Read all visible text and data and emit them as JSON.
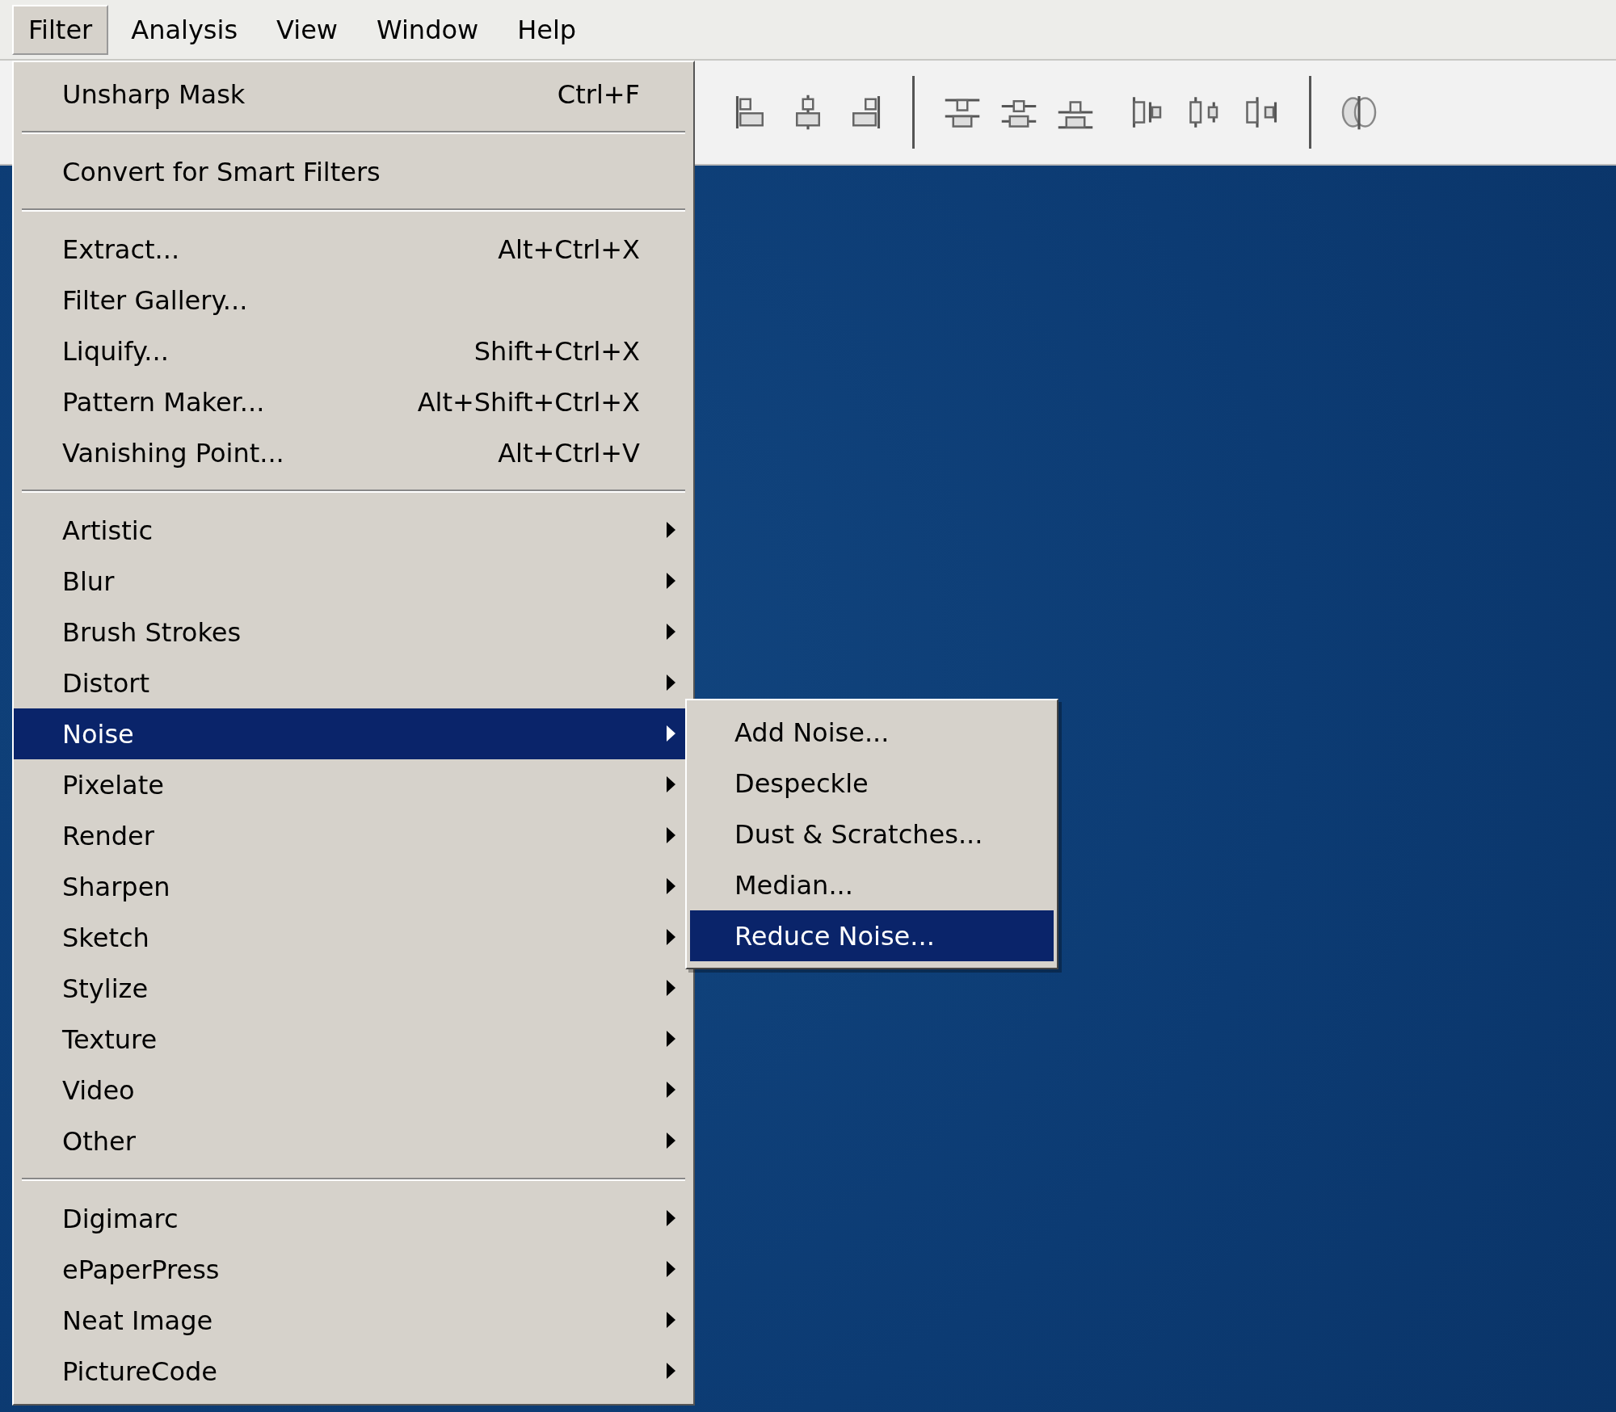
{
  "menu_bar": [
    {
      "label": "Filter",
      "selected": true
    },
    {
      "label": "Analysis",
      "selected": false
    },
    {
      "label": "View",
      "selected": false
    },
    {
      "label": "Window",
      "selected": false
    },
    {
      "label": "Help",
      "selected": false
    }
  ],
  "filter_menu": {
    "sections": [
      {
        "items": [
          {
            "label": "Unsharp Mask",
            "shortcut": "Ctrl+F",
            "submenu": false,
            "selected": false
          }
        ]
      },
      {
        "items": [
          {
            "label": "Convert for Smart Filters",
            "submenu": false,
            "selected": false
          }
        ]
      },
      {
        "items": [
          {
            "label": "Extract...",
            "shortcut": "Alt+Ctrl+X",
            "submenu": false,
            "selected": false
          },
          {
            "label": "Filter Gallery...",
            "submenu": false,
            "selected": false
          },
          {
            "label": "Liquify...",
            "shortcut": "Shift+Ctrl+X",
            "submenu": false,
            "selected": false
          },
          {
            "label": "Pattern Maker...",
            "shortcut": "Alt+Shift+Ctrl+X",
            "submenu": false,
            "selected": false
          },
          {
            "label": "Vanishing Point...",
            "shortcut": "Alt+Ctrl+V",
            "submenu": false,
            "selected": false
          }
        ]
      },
      {
        "items": [
          {
            "label": "Artistic",
            "submenu": true,
            "selected": false
          },
          {
            "label": "Blur",
            "submenu": true,
            "selected": false
          },
          {
            "label": "Brush Strokes",
            "submenu": true,
            "selected": false
          },
          {
            "label": "Distort",
            "submenu": true,
            "selected": false
          },
          {
            "label": "Noise",
            "submenu": true,
            "selected": true,
            "children": [
              {
                "label": "Add Noise...",
                "selected": false
              },
              {
                "label": "Despeckle",
                "selected": false
              },
              {
                "label": "Dust & Scratches...",
                "selected": false
              },
              {
                "label": "Median...",
                "selected": false
              },
              {
                "label": "Reduce Noise...",
                "selected": true
              }
            ]
          },
          {
            "label": "Pixelate",
            "submenu": true,
            "selected": false
          },
          {
            "label": "Render",
            "submenu": true,
            "selected": false
          },
          {
            "label": "Sharpen",
            "submenu": true,
            "selected": false
          },
          {
            "label": "Sketch",
            "submenu": true,
            "selected": false
          },
          {
            "label": "Stylize",
            "submenu": true,
            "selected": false
          },
          {
            "label": "Texture",
            "submenu": true,
            "selected": false
          },
          {
            "label": "Video",
            "submenu": true,
            "selected": false
          },
          {
            "label": "Other",
            "submenu": true,
            "selected": false
          }
        ]
      },
      {
        "items": [
          {
            "label": "Digimarc",
            "submenu": true,
            "selected": false
          },
          {
            "label": "ePaperPress",
            "submenu": true,
            "selected": false
          },
          {
            "label": "Neat Image",
            "submenu": true,
            "selected": false
          },
          {
            "label": "PictureCode",
            "submenu": true,
            "selected": false
          }
        ]
      }
    ]
  }
}
